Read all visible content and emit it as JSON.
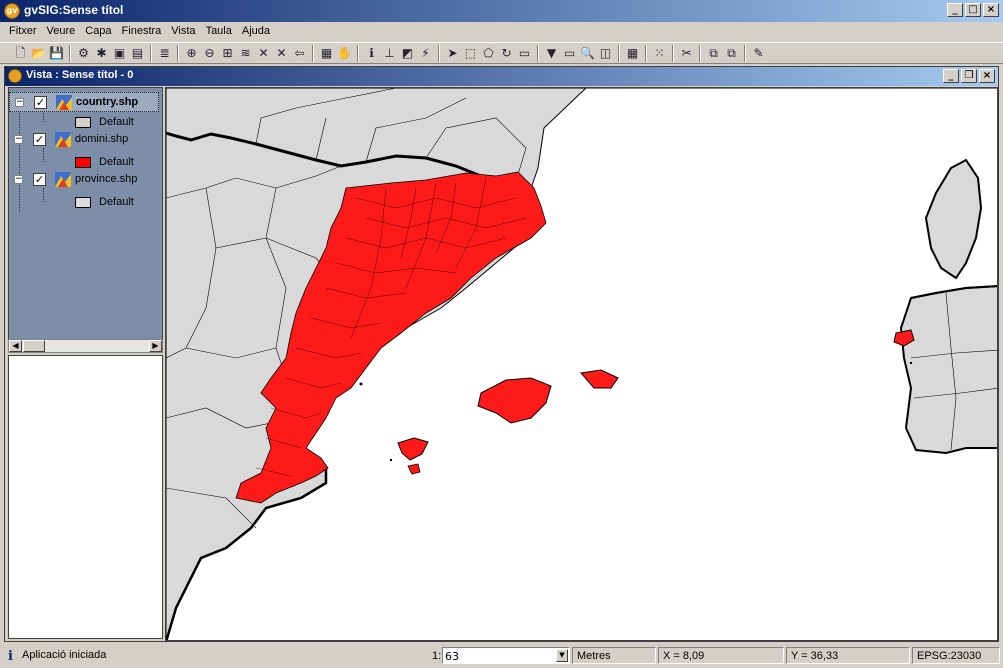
{
  "app": {
    "title": "gvSIG:Sense títol",
    "icon": "gvsig-logo-icon"
  },
  "menu": [
    "Fitxer",
    "Veure",
    "Capa",
    "Finestra",
    "Vista",
    "Taula",
    "Ajuda"
  ],
  "view": {
    "title": "Vista : Sense títol - 0"
  },
  "layers": [
    {
      "name": "country.shp",
      "checked": true,
      "legend_label": "Default",
      "fill": "#d4d0c8",
      "selected": true
    },
    {
      "name": "domini.shp",
      "checked": true,
      "legend_label": "Default",
      "fill": "#ff0000",
      "selected": false
    },
    {
      "name": "province.shp",
      "checked": true,
      "legend_label": "Default",
      "fill": "#dcdcdc",
      "selected": false
    }
  ],
  "status": {
    "message": "Aplicació iniciada",
    "scale_prefix": "1:",
    "scale_value": "63",
    "units": "Metres",
    "x": "X = 8,09",
    "y": "Y = 36,33",
    "crs": "EPSG:23030"
  },
  "colors": {
    "land": "#d9d9d9",
    "domain": "#ff0000",
    "sea": "#ffffff",
    "toc_bg": "#7d8fa8"
  }
}
